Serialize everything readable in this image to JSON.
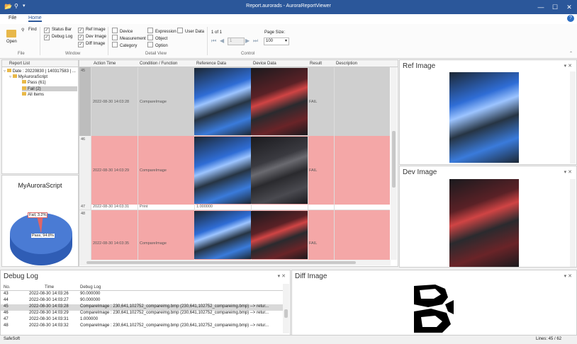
{
  "app": {
    "title": "Report.aurorads - AuroraReportViewer",
    "qa_icon": "folder-icon",
    "binoculars_icon": "binoculars-icon",
    "qa_dropdown": "▾"
  },
  "window_controls": {
    "minimize": "—",
    "maximize": "☐",
    "close": "✕"
  },
  "ribbon": {
    "tabs": [
      "File",
      "Home"
    ],
    "active_tab": "Home",
    "file_group": {
      "open": "Open",
      "find": "Find",
      "label": "File"
    },
    "window_group": {
      "label": "Window",
      "items": [
        {
          "label": "Status Bar",
          "checked": true
        },
        {
          "label": "Debug Log",
          "checked": true
        },
        {
          "label": "Ref Image",
          "checked": true
        },
        {
          "label": "Dev Image",
          "checked": true
        },
        {
          "label": "Diff Image",
          "checked": true
        }
      ]
    },
    "detail_group": {
      "label": "Detail View",
      "items": [
        {
          "label": "Device",
          "checked": false
        },
        {
          "label": "Measurement",
          "checked": false
        },
        {
          "label": "Category",
          "checked": false
        },
        {
          "label": "Expression",
          "checked": false
        },
        {
          "label": "Object",
          "checked": false
        },
        {
          "label": "Option",
          "checked": false
        },
        {
          "label": "User Data",
          "checked": false
        }
      ]
    },
    "control_group": {
      "label": "Control",
      "page_info": "1 of 1",
      "page_value": "1",
      "page_size_label": "Page Size:",
      "page_size_value": "100"
    },
    "help_icon": "?"
  },
  "tree": {
    "header": "Report List",
    "items": [
      {
        "label": "Date : 20220830 | 140317583 | ...",
        "level": 0
      },
      {
        "label": "MyAuroraScript",
        "level": 1
      },
      {
        "label": "Pass (61)",
        "level": 2
      },
      {
        "label": "Fail (2)",
        "level": 2,
        "selected": true
      },
      {
        "label": "All Items",
        "level": 2
      }
    ]
  },
  "pie": {
    "title": "MyAuroraScript",
    "fail_label": "Fail, 3.2%",
    "pass_label": "Pass, 94.8%"
  },
  "chart_data": {
    "type": "pie",
    "title": "MyAuroraScript",
    "slices": [
      {
        "name": "Fail",
        "value": 3.2
      },
      {
        "name": "Pass",
        "value": 94.8
      }
    ]
  },
  "grid": {
    "columns": [
      "",
      "Action Time",
      "Condition / Function",
      "Reference Data",
      "Device Data",
      "Result",
      "Description"
    ],
    "rows": [
      {
        "no": "45",
        "time": "2022-08-30 14:03:28",
        "function": "CompareImage",
        "ref": "",
        "result": "FAIL",
        "kind": "fail-gray"
      },
      {
        "no": "46",
        "time": "2022-08-30 14:03:29",
        "function": "CompareImage",
        "ref": "",
        "result": "FAIL",
        "kind": "fail"
      },
      {
        "no": "47",
        "time": "2022-08-30 14:03:31",
        "function": "Print",
        "ref": "1.000000",
        "result": "",
        "kind": "plain"
      },
      {
        "no": "48",
        "time": "2022-08-30 14:03:35",
        "function": "CompareImage",
        "ref": "",
        "result": "FAIL",
        "kind": "fail"
      }
    ]
  },
  "ref_panel": {
    "title": "Ref Image"
  },
  "dev_panel": {
    "title": "Dev Image"
  },
  "diff_panel": {
    "title": "Diff Image"
  },
  "debug": {
    "title": "Debug Log",
    "headers": [
      "No.",
      "Time",
      "Debug Log"
    ],
    "rows": [
      {
        "no": "43",
        "time": "2022-08-30 14:03:26",
        "log": "90.000000"
      },
      {
        "no": "44",
        "time": "2022-08-30 14:03:27",
        "log": "90.000000"
      },
      {
        "no": "45",
        "time": "2022-08-30 14:03:28",
        "log": "CompareImage : 230,641,102752_compareimg.bmp (230,641,102752_compareimg.bmp) --> retur..."
      },
      {
        "no": "46",
        "time": "2022-08-30 14:03:29",
        "log": "CompareImage : 230,641,102752_compareimg.bmp (230,641,102752_compareimg.bmp) --> retur..."
      },
      {
        "no": "47",
        "time": "2022-08-30 14:03:31",
        "log": "1.000000"
      },
      {
        "no": "48",
        "time": "2022-08-30 14:03:32",
        "log": "CompareImage : 230,641,102752_compareimg.bmp (230,641,102752_compareimg.bmp) --> retur..."
      }
    ]
  },
  "status": {
    "left": "SafeSoft",
    "right": "Lines: 45 / 62"
  },
  "colors": {
    "accent": "#2b579a",
    "fail_row": "#f4a7a7",
    "gray_row": "#cfcfcf",
    "pie_pass": "#4a7bd4",
    "pie_fail": "#e06666"
  }
}
